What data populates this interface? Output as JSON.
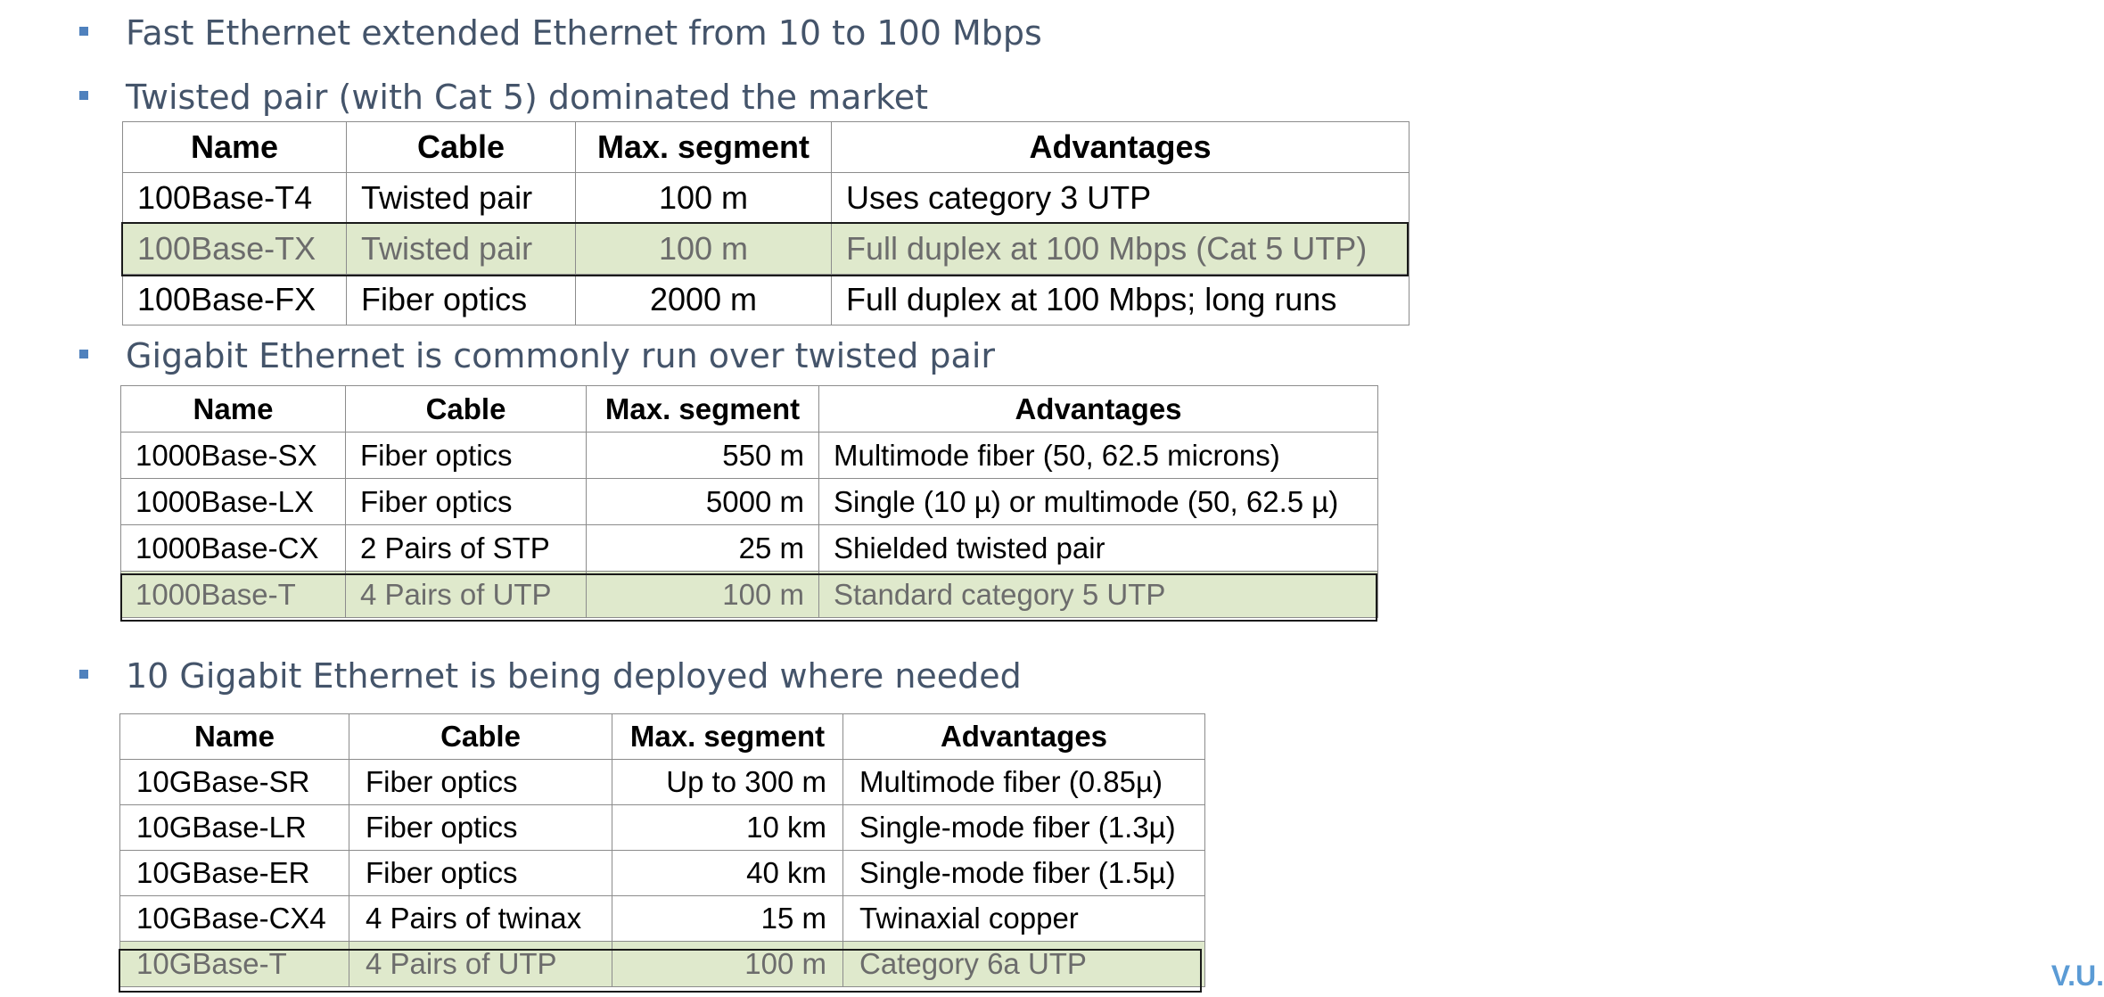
{
  "bullets": [
    "Fast Ethernet extended Ethernet from 10 to 100 Mbps",
    "Twisted pair (with Cat 5) dominated the market",
    "Gigabit Ethernet is commonly run over twisted pair",
    "10 Gigabit Ethernet is being deployed where needed"
  ],
  "fast_ethernet_table": {
    "headers": [
      "Name",
      "Cable",
      "Max. segment",
      "Advantages"
    ],
    "rows": [
      [
        "100Base-T4",
        "Twisted pair",
        "100 m",
        "Uses category 3 UTP"
      ],
      [
        "100Base-TX",
        "Twisted pair",
        "100 m",
        "Full duplex at 100 Mbps (Cat 5 UTP)"
      ],
      [
        "100Base-FX",
        "Fiber optics",
        "2000 m",
        "Full duplex at 100 Mbps; long runs"
      ]
    ],
    "highlighted_row": 1,
    "highlight_color": "#dfe9cc"
  },
  "gigabit_table": {
    "headers": [
      "Name",
      "Cable",
      "Max. segment",
      "Advantages"
    ],
    "rows": [
      [
        "1000Base-SX",
        "Fiber optics",
        "550 m",
        "Multimode fiber (50, 62.5 microns)"
      ],
      [
        "1000Base-LX",
        "Fiber optics",
        "5000 m",
        "Single (10 µ) or multimode (50, 62.5 µ)"
      ],
      [
        "1000Base-CX",
        "2 Pairs of STP",
        "25 m",
        "Shielded twisted pair"
      ],
      [
        "1000Base-T",
        "4 Pairs of UTP",
        "100 m",
        "Standard category 5 UTP"
      ]
    ],
    "highlighted_row": 3,
    "highlight_color": "#dfe9cc"
  },
  "ten_gigabit_table": {
    "headers": [
      "Name",
      "Cable",
      "Max. segment",
      "Advantages"
    ],
    "rows": [
      [
        "10GBase-SR",
        "Fiber optics",
        "Up to 300 m",
        "Multimode fiber (0.85µ)"
      ],
      [
        "10GBase-LR",
        "Fiber optics",
        "10 km",
        "Single-mode fiber (1.3µ)"
      ],
      [
        "10GBase-ER",
        "Fiber optics",
        "40 km",
        "Single-mode fiber (1.5µ)"
      ],
      [
        "10GBase-CX4",
        "4 Pairs of twinax",
        "15 m",
        "Twinaxial copper"
      ],
      [
        "10GBase-T",
        "4 Pairs of UTP",
        "100 m",
        "Category 6a UTP"
      ]
    ],
    "highlighted_row": 4,
    "highlight_color": "#dfe9cc"
  },
  "footer": {
    "text": "V.U."
  },
  "colors": {
    "bullet": "#4f81bd",
    "bullet_text": "#44546a",
    "footer": "#5b9bd5"
  }
}
